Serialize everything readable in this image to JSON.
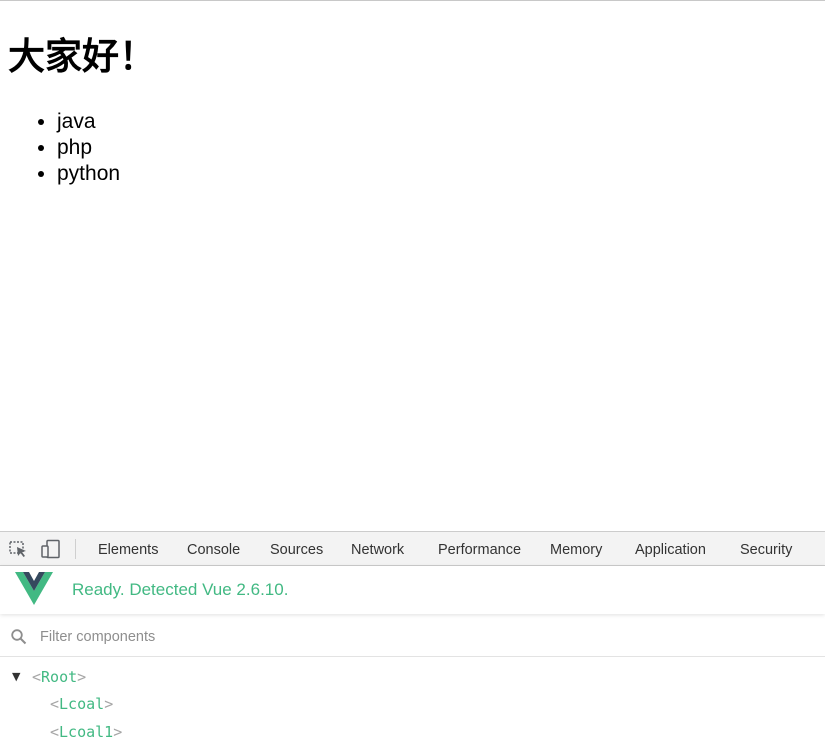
{
  "page": {
    "heading": "大家好！",
    "list": [
      "java",
      "php",
      "python"
    ]
  },
  "devtools": {
    "tabs": [
      "Elements",
      "Console",
      "Sources",
      "Network",
      "Performance",
      "Memory",
      "Application",
      "Security"
    ],
    "vue": {
      "status": "Ready. Detected Vue 2.6.10.",
      "filter_placeholder": "Filter components",
      "tree": [
        {
          "name": "Root",
          "expanded": true
        },
        {
          "name": "Lcoal"
        },
        {
          "name": "Lcoal1"
        }
      ]
    }
  },
  "colors": {
    "vue_green": "#42b983",
    "vue_dark": "#35495e"
  },
  "icons": [
    "inspect-element-icon",
    "device-toolbar-icon",
    "vue-logo",
    "search-icon",
    "triangle-down-icon"
  ]
}
